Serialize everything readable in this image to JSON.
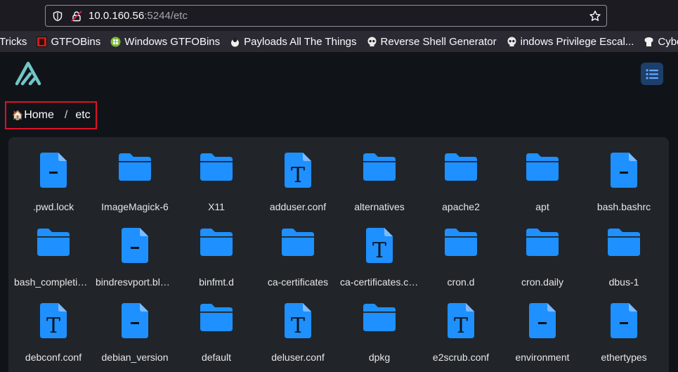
{
  "browser": {
    "url_host": "10.0.160.56",
    "url_rest": ":5244/etc",
    "bookmarks": [
      {
        "label": "Tricks",
        "icon": "none"
      },
      {
        "label": "GTFOBins",
        "icon": "gtfobins-icon"
      },
      {
        "label": "Windows GTFOBins",
        "icon": "windows-gtfobins-icon"
      },
      {
        "label": "Payloads All The Things",
        "icon": "payloads-icon"
      },
      {
        "label": "Reverse Shell Generator",
        "icon": "skull-icon"
      },
      {
        "label": "indows Privilege Escal...",
        "icon": "skull-icon"
      },
      {
        "label": "CyberChef",
        "icon": "chef-icon"
      }
    ]
  },
  "breadcrumb": {
    "home": "Home",
    "separator": "/",
    "current": "etc"
  },
  "colors": {
    "accent": "#1e90ff",
    "highlight_border": "#e0102a",
    "logo": "#70c6c7"
  },
  "files": [
    {
      "name": ".pwd.lock",
      "type": "file"
    },
    {
      "name": "ImageMagick-6",
      "type": "folder"
    },
    {
      "name": "X11",
      "type": "folder"
    },
    {
      "name": "adduser.conf",
      "type": "text"
    },
    {
      "name": "alternatives",
      "type": "folder"
    },
    {
      "name": "apache2",
      "type": "folder"
    },
    {
      "name": "apt",
      "type": "folder"
    },
    {
      "name": "bash.bashrc",
      "type": "file"
    },
    {
      "name": "bash_completion.d",
      "type": "folder"
    },
    {
      "name": "bindresvport.blacklist",
      "type": "file"
    },
    {
      "name": "binfmt.d",
      "type": "folder"
    },
    {
      "name": "ca-certificates",
      "type": "folder"
    },
    {
      "name": "ca-certificates.conf",
      "type": "text"
    },
    {
      "name": "cron.d",
      "type": "folder"
    },
    {
      "name": "cron.daily",
      "type": "folder"
    },
    {
      "name": "dbus-1",
      "type": "folder"
    },
    {
      "name": "debconf.conf",
      "type": "text"
    },
    {
      "name": "debian_version",
      "type": "file"
    },
    {
      "name": "default",
      "type": "folder"
    },
    {
      "name": "deluser.conf",
      "type": "text"
    },
    {
      "name": "dpkg",
      "type": "folder"
    },
    {
      "name": "e2scrub.conf",
      "type": "text"
    },
    {
      "name": "environment",
      "type": "file"
    },
    {
      "name": "ethertypes",
      "type": "file"
    }
  ]
}
